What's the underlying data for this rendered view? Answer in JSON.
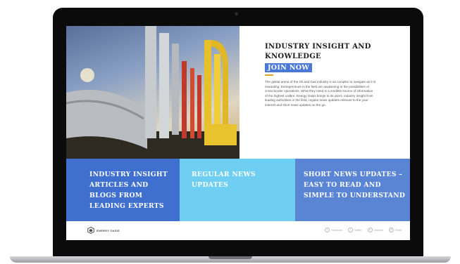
{
  "intro": {
    "title": "INDUSTRY INSIGHT AND KNOWLEDGE",
    "join_label": "JOIN NOW",
    "body": "The global arena of the Oil and Gas industry is as complex to navigate as it is rewarding. Entrepreneurs in the field are awakening to the possibilities of cross-border operations. What they need is a credible source of information of the highest calibre. Energy Oasis brings to its users, industry insight from leading authorities in the field, regular news updates relevant to the your interest and short news updates on the go."
  },
  "tiles": [
    {
      "text": "INDUSTRY INSIGHT ARTICLES AND BLOGS FROM LEADING EXPERTS"
    },
    {
      "text": "REGULAR NEWS UPDATES"
    },
    {
      "text": "SHORT NEWS UPDATES – EASY TO READ AND SIMPLE TO UNDERSTAND"
    }
  ],
  "footer": {
    "logo_text": "ENERGY OASIS",
    "social": [
      {
        "icon": "facebook-icon",
        "glyph": "f",
        "label": "Facebook"
      },
      {
        "icon": "twitter-icon",
        "glyph": "t",
        "label": "Twitter"
      },
      {
        "icon": "linkedin-icon",
        "glyph": "in",
        "label": "Linkedin"
      },
      {
        "icon": "mail-icon",
        "glyph": "@",
        "label": "Email"
      }
    ]
  },
  "colors": {
    "tile_dark_blue": "#3f6fcf",
    "tile_light_blue": "#6fcff3",
    "tile_mid_blue": "#5a84d4",
    "button_blue": "#4a78d6",
    "accent_orange": "#e6a32b"
  }
}
